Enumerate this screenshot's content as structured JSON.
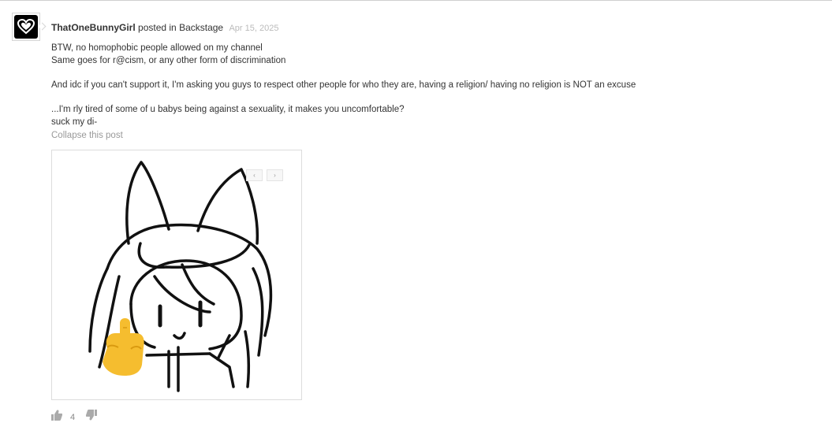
{
  "post": {
    "author": "ThatOneBunnyGirl",
    "action": "posted in",
    "channel": "Backstage",
    "date": "Apr 15, 2025",
    "lines": [
      "BTW, no homophobic people allowed on my channel",
      "Same goes for r@cism, or any other form of discrimination",
      "And idc if you can't support it, I'm asking you guys to respect other people for who they are, having a religion/ having no religion is NOT an excuse",
      "...I'm rly tired of some of u babys being against a sexuality, it makes you uncomfortable?",
      "suck my di-"
    ],
    "collapse_label": "Collapse this post"
  },
  "gallery": {
    "prev_label": "‹",
    "next_label": "›"
  },
  "reactions": {
    "like_count": "4",
    "like_icon": "thumbs-up-icon",
    "dislike_icon": "thumbs-down-icon"
  },
  "colors": {
    "text": "#333333",
    "muted": "#999999",
    "date": "#bbbbbb",
    "border": "#dcdcdc"
  }
}
